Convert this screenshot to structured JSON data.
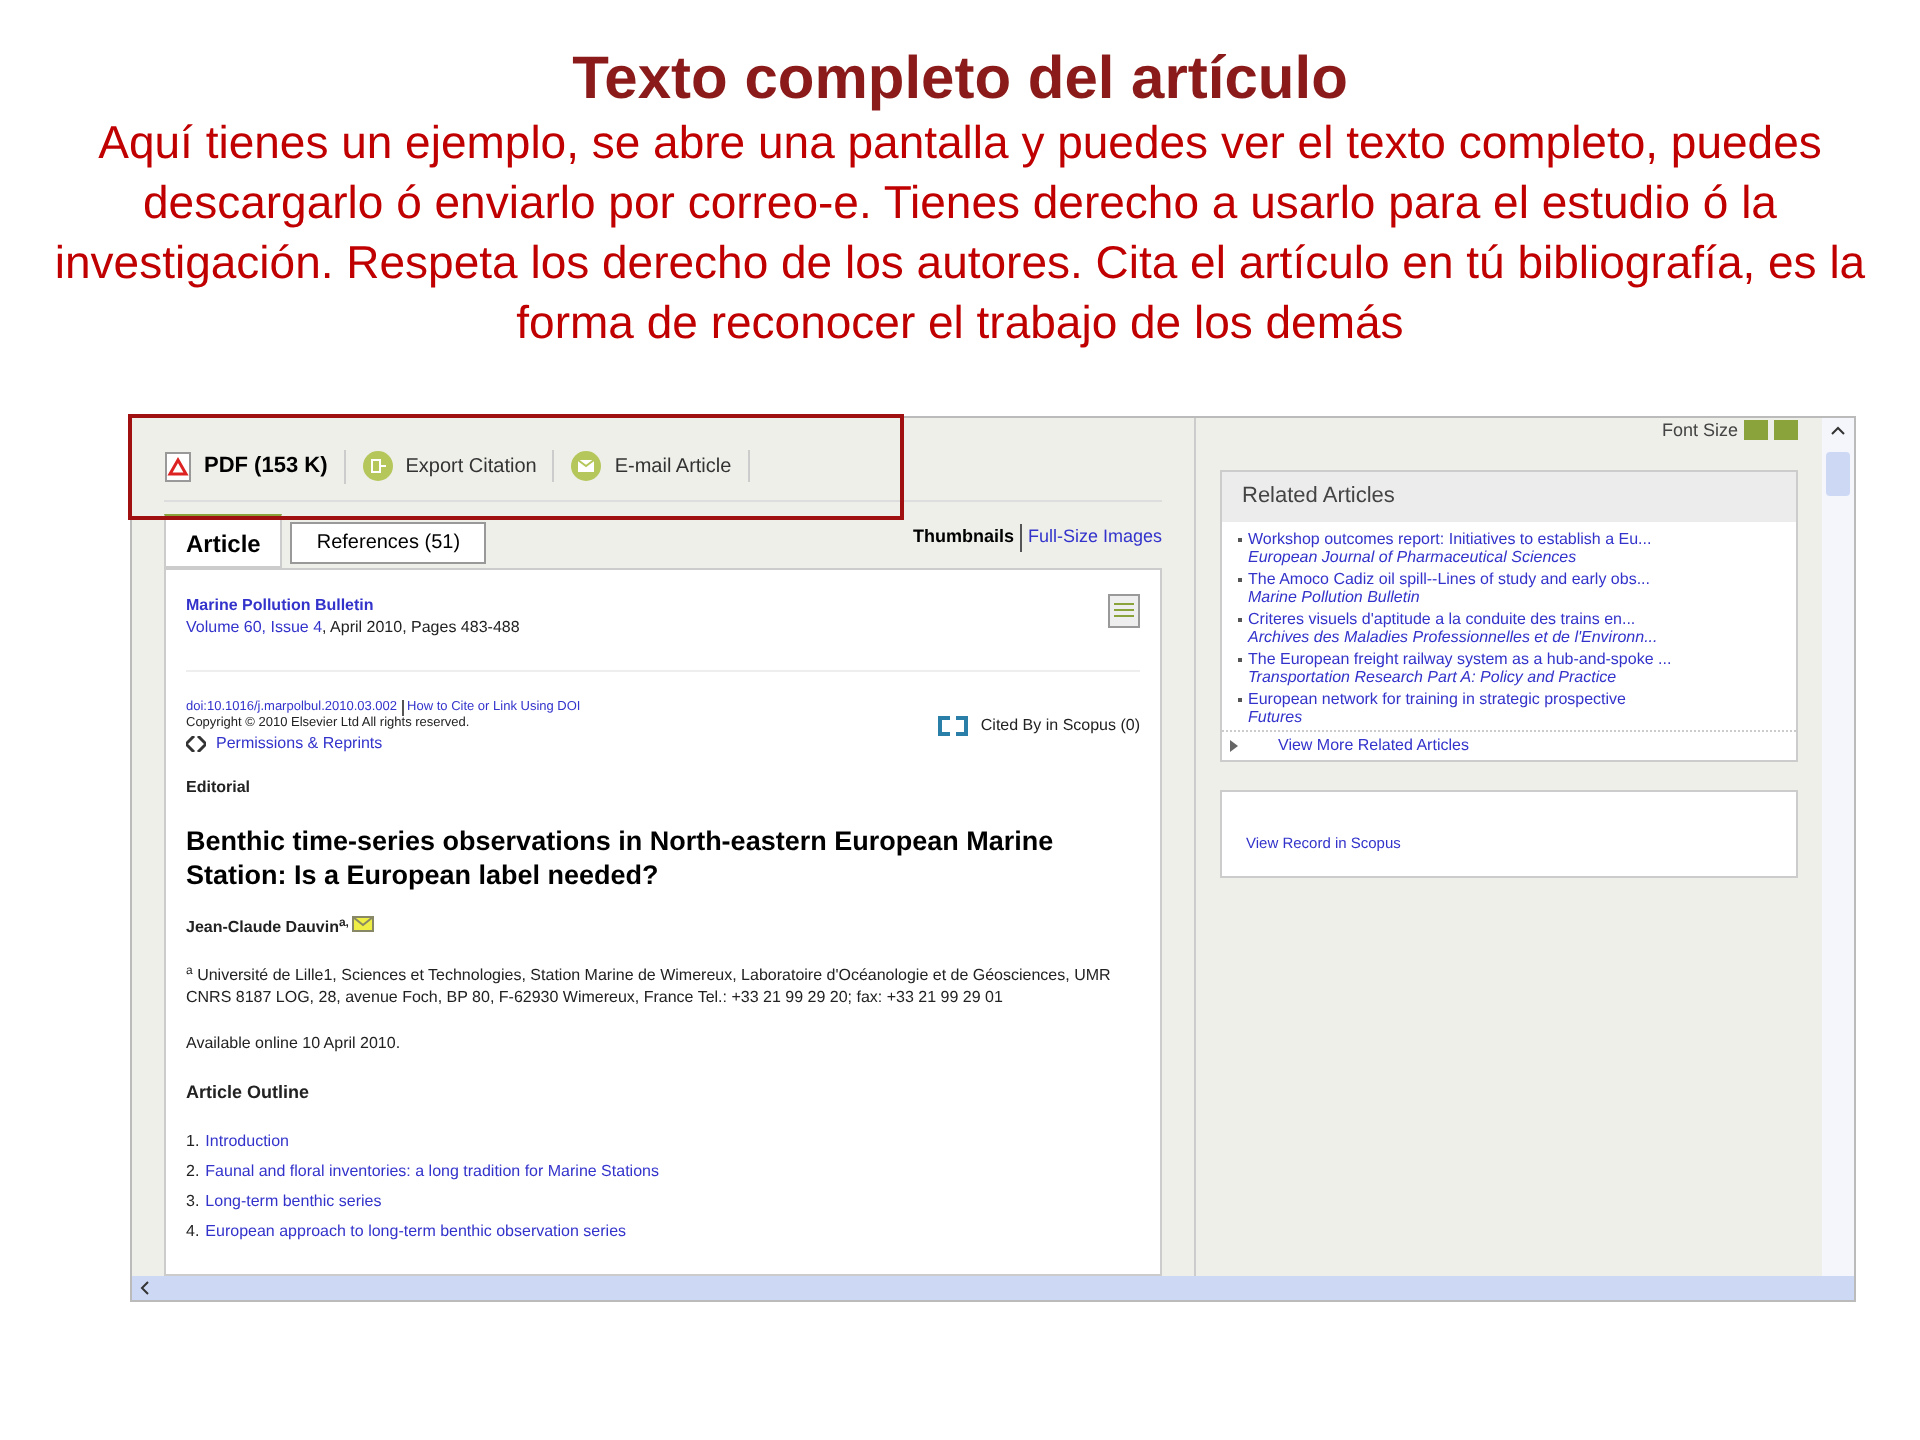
{
  "slide": {
    "title": "Texto completo del artículo",
    "text": "Aquí tienes un ejemplo, se abre una pantalla y puedes ver el texto completo, puedes descargarlo ó enviarlo por correo-e. Tienes derecho a usarlo para el estudio ó la investigación. Respeta los derecho de los autores. Cita el artículo en tú bibliografía, es la forma de reconocer el trabajo de los demás"
  },
  "screenshot": {
    "toolbar": [
      {
        "kind": "pdf",
        "label": "PDF (153 K)"
      },
      {
        "kind": "export",
        "label": "Export Citation"
      },
      {
        "kind": "email",
        "label": "E-mail Article"
      }
    ],
    "tabs": [
      {
        "label": "Article",
        "selected": true
      },
      {
        "label": "References (51)",
        "selected": false
      }
    ],
    "image_links": [
      "Thumbnails",
      "Full-Size Images"
    ],
    "article": {
      "journal": "Marine Pollution Bulletin",
      "volume": "Volume 60, Issue 4",
      "details": ", April 2010, Pages 483-488",
      "doi": "doi:10.1016/j.marpolbul.2010.03.002",
      "how_to_cite": "How to Cite or Link Using DOI",
      "copyright": "Copyright © 2010 Elsevier Ltd All rights reserved.",
      "permissions": "Permissions & Reprints",
      "cited_by": "Cited By in Scopus (0)",
      "section": "Editorial",
      "title": "Benthic time-series observations in North-eastern European Marine Station: Is a European label needed?",
      "author": "Jean-Claude Dauvin$^{a,}$",
      "affiliation": "$^{a}$ Université de Lille1, Sciences et Technologies, Station Marine de Wimereux, Laboratoire d'Océanologie et de Géosciences, UMR CNRS 8187 LOG, 28, avenue Foch, BP 80, F-62930 Wimereux, France Tel.: +33 21 99 29 20; fax: +33 21 99 29 01",
      "available": "Available online 10 April 2010.",
      "outline_heading": "Article Outline",
      "outline": [
        {
          "number": "1.",
          "label": "Introduction"
        },
        {
          "number": "2.",
          "label": "Faunal and floral inventories: a long tradition for Marine Stations"
        },
        {
          "number": "3.",
          "label": "Long-term benthic series"
        },
        {
          "number": "4.",
          "label": "European approach to long-term benthic observation series"
        }
      ]
    },
    "font_size_label": "Font Size",
    "related": {
      "title": "Related Articles",
      "items": [
        {
          "title": "Workshop outcomes report: Initiatives to establish a Eu...",
          "source": "European Journal of Pharmaceutical Sciences"
        },
        {
          "title": "The Amoco Cadiz oil spill--Lines of study and early obs...",
          "source": "Marine Pollution Bulletin"
        },
        {
          "title": "Criteres visuels d'aptitude a la conduite des trains en...",
          "source": "Archives des Maladies Professionnelles et de l'Environn..."
        },
        {
          "title": "The European freight railway system as a hub-and-spoke ...",
          "source": "Transportation Research Part A: Policy and Practice"
        },
        {
          "title": "European network for training in strategic prospective",
          "source": "Futures"
        }
      ],
      "more": "View More Related Articles"
    },
    "scopus_link": "View Record in Scopus"
  }
}
